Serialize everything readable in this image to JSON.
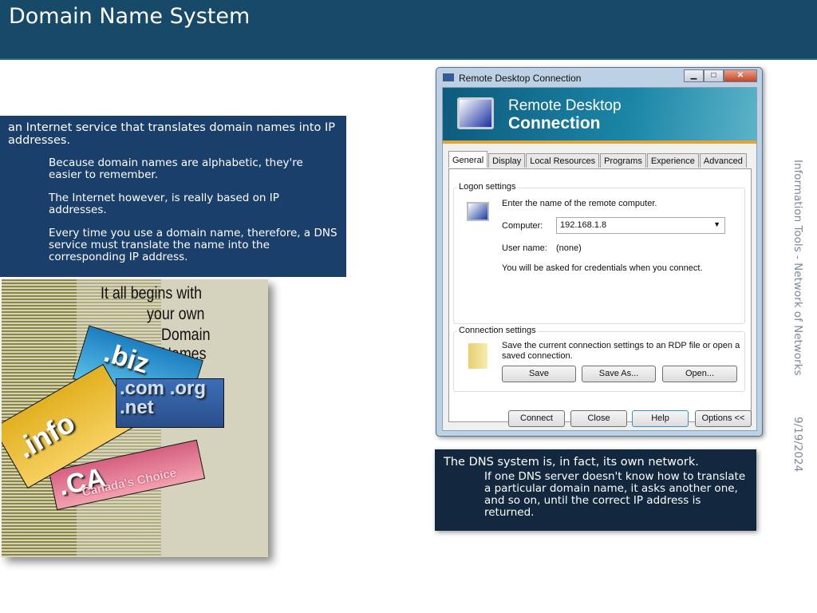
{
  "slide": {
    "title": "Domain Name System"
  },
  "left_box": {
    "main": "an Internet service that translates domain names into IP addresses.",
    "subs": [
      "Because domain names are alphabetic, they're easier to remember.",
      "The Internet however, is really based on IP addresses.",
      "Every time you use a domain name, therefore, a DNS service must translate the name into the corresponding IP address."
    ]
  },
  "image": {
    "lines": [
      "It all begins with",
      "your own",
      "Domain Names"
    ],
    "cards": [
      ".biz",
      ".info",
      ".com",
      ".net",
      ".org",
      ".CA",
      "Canada's Choice"
    ]
  },
  "rdp": {
    "window_title": "Remote Desktop Connection",
    "banner_line1": "Remote Desktop",
    "banner_line2": "Connection",
    "tabs": [
      "General",
      "Display",
      "Local Resources",
      "Programs",
      "Experience",
      "Advanced"
    ],
    "active_tab": "General",
    "logon_label": "Logon settings",
    "enter_text": "Enter the name of the remote computer.",
    "computer_label": "Computer:",
    "computer_value": "192.168.1.8",
    "user_label": "User name:",
    "user_value": "(none)",
    "cred_text": "You will be asked for credentials when you connect.",
    "conn_label": "Connection settings",
    "conn_text": "Save the current connection settings to an RDP file or open a saved connection.",
    "save": "Save",
    "save_as": "Save As...",
    "open": "Open...",
    "connect": "Connect",
    "close": "Close",
    "help": "Help",
    "options": "Options <<"
  },
  "dns_box": {
    "main": "The DNS system is, in fact, its own network.",
    "sub": "If one DNS server doesn't know how to translate a particular domain name, it asks another one, and so on, until the correct IP address is returned."
  },
  "sidebar": {
    "footer": "Information Tools - Network of Networks",
    "date": "9/19/2024"
  }
}
